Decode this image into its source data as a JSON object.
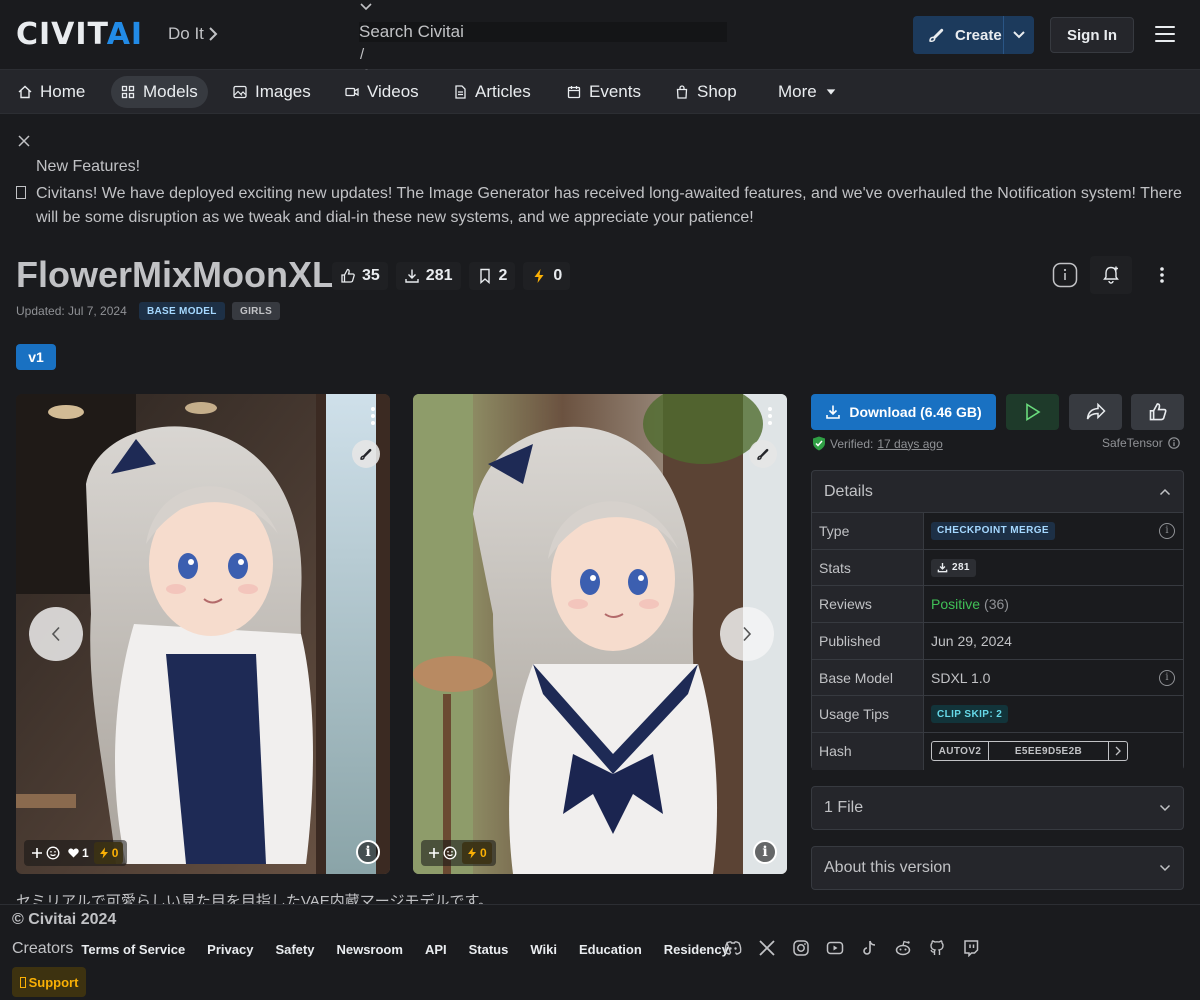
{
  "header": {
    "logo_main": "CIVIT",
    "logo_accent": "AI",
    "tagline": "Do It",
    "search_placeholder": "Search Civitai",
    "search_shortcut": "/",
    "create_label": "Create",
    "signin_label": "Sign In"
  },
  "nav": {
    "items": [
      {
        "label": "Home",
        "icon": "home-icon"
      },
      {
        "label": "Models",
        "icon": "grid-icon"
      },
      {
        "label": "Images",
        "icon": "image-icon"
      },
      {
        "label": "Videos",
        "icon": "video-icon"
      },
      {
        "label": "Articles",
        "icon": "article-icon"
      },
      {
        "label": "Events",
        "icon": "calendar-icon"
      },
      {
        "label": "Shop",
        "icon": "shop-icon"
      },
      {
        "label": "More",
        "icon": "caret-down-icon"
      }
    ],
    "active": "Models"
  },
  "banner": {
    "title": "New Features!",
    "text": "Civitans! We have deployed exciting new updates! The Image Generator has received long-awaited features, and we've overhauled the Notification system! There will be some disruption as we tweak and dial-in these new systems, and we appreciate your patience!"
  },
  "model": {
    "name": "FlowerMixMoonXL",
    "likes": "35",
    "downloads": "281",
    "bookmarks": "2",
    "buzz": "0",
    "updated": "Updated: Jul 7, 2024",
    "tags": [
      "BASE MODEL",
      "GIRLS"
    ],
    "version": "v1",
    "description": "セミリアルで可愛らしい見た目を目指したVAE内蔵マージモデルです。"
  },
  "images": [
    {
      "likes": "1",
      "buzz": "0"
    },
    {
      "likes": "",
      "buzz": "0"
    }
  ],
  "download": {
    "label": "Download (6.46 GB)",
    "verified_prefix": "Verified:",
    "verified_when": "17 days ago",
    "format": "SafeTensor"
  },
  "details": {
    "title": "Details",
    "rows": {
      "type_label": "Type",
      "type_value": "CHECKPOINT MERGE",
      "stats_label": "Stats",
      "stats_value": "281",
      "reviews_label": "Reviews",
      "reviews_value": "Positive",
      "reviews_count": "(36)",
      "published_label": "Published",
      "published_value": "Jun 29, 2024",
      "base_label": "Base Model",
      "base_value": "SDXL 1.0",
      "tips_label": "Usage Tips",
      "tips_value": "CLIP SKIP: 2",
      "hash_label": "Hash",
      "hash_type": "AUTOV2",
      "hash_value": "E5EE9D5E2B"
    }
  },
  "accordions": {
    "files": "1 File",
    "about": "About this version"
  },
  "footer": {
    "copyright": "© Civitai 2024",
    "links": [
      "Creators",
      "Terms of Service",
      "Privacy",
      "Safety",
      "Newsroom",
      "API",
      "Status",
      "Wiki",
      "Education",
      "Residency"
    ],
    "support": "Support"
  },
  "colors": {
    "accent": "#228be6",
    "primary_button": "#1971c2",
    "positive": "#40c057",
    "buzz": "#fab005"
  }
}
